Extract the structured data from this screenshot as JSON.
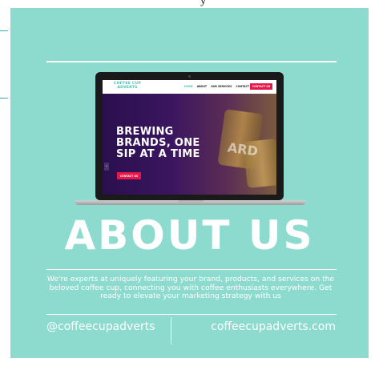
{
  "background": {
    "fragment_text": "y"
  },
  "colors": {
    "card": "#8ddbcf",
    "accent": "#e8174a",
    "brand_teal": "#4fbfb1",
    "hero_purple": "#2a0f4d"
  },
  "website_mockup": {
    "logo_line1": "COFFEE CUP",
    "logo_line2": "ADVERTS",
    "nav": [
      "HOME",
      "ABOUT",
      "OUR SERVICES",
      "CONTACT"
    ],
    "nav_cta": "CONTACT US",
    "hero_title": "BREWING BRANDS, ONE SIP AT A TIME",
    "hero_cta": "CONTACT US",
    "hero_cup_text": "ARD",
    "hero_arrow": "‹"
  },
  "about": {
    "title": "ABOUT US",
    "body": "We're experts at uniquely featuring your brand, products, and services on the beloved coffee cup, connecting you with coffee enthusiasts everywhere. Get ready to elevate your marketing strategy with us"
  },
  "footer": {
    "handle": "@coffeecupadverts",
    "website": "coffeecupadverts.com"
  }
}
